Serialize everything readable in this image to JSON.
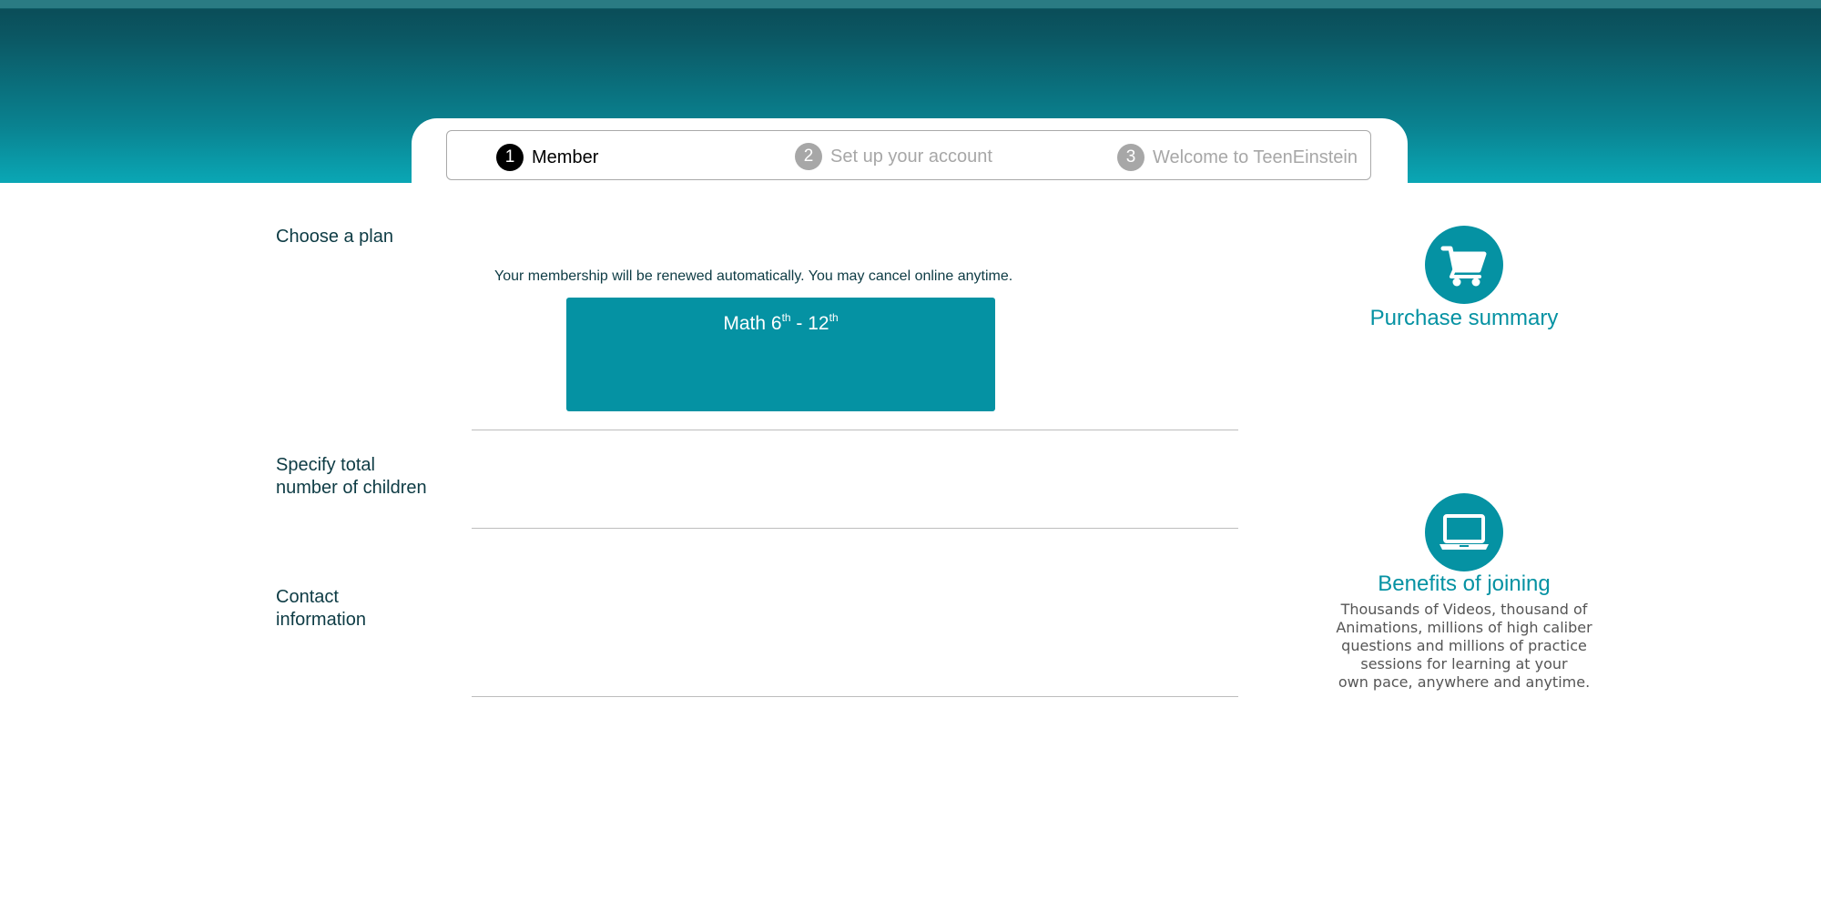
{
  "stepper": {
    "steps": [
      {
        "number": "1",
        "label": "Member",
        "state": "active"
      },
      {
        "number": "2",
        "label": "Set up your account",
        "state": "inactive"
      },
      {
        "number": "3",
        "label": "Welcome to TeenEinstein",
        "state": "inactive"
      }
    ]
  },
  "sections": {
    "choose_plan": "Choose a plan",
    "children": "Specify total\nnumber of children",
    "contact": "Contact\ninformation"
  },
  "plan": {
    "renewal_note": "Your membership will be renewed automatically. You may cancel online anytime.",
    "name_prefix": "Math 6",
    "name_sup1": "th",
    "name_middle": " - 12",
    "name_sup2": "th"
  },
  "sidebar": {
    "purchase_title": "Purchase summary",
    "purchase_icon": "cart-icon",
    "benefits_title": "Benefits of joining",
    "benefits_icon": "laptop-icon",
    "benefits_lines": [
      "Thousands of Videos, thousand of",
      "Animations, millions of high caliber",
      "questions and millions of practice",
      "sessions for learning at your",
      "own pace, anywhere and anytime."
    ]
  },
  "colors": {
    "accent": "#0592a3",
    "header_dark": "#0a4a55",
    "header_light": "#0aa7b5",
    "inactive_step": "#a7a7a7"
  }
}
